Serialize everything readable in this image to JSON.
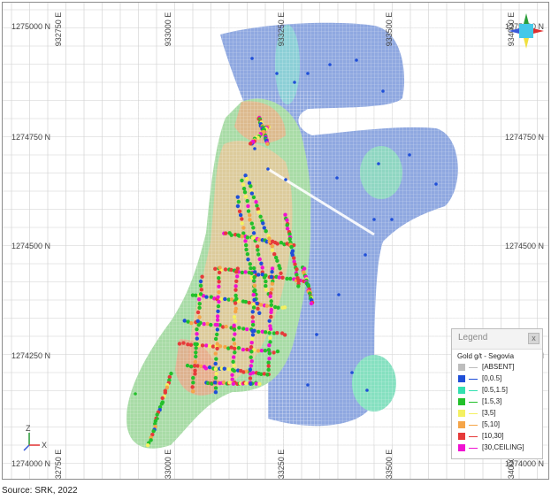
{
  "grid_labels": {
    "easting": [
      "932750 E",
      "933000 E",
      "933250 E",
      "933500 E",
      "934000 E"
    ],
    "northing": [
      "1275000 N",
      "1274750 N",
      "1274500 N",
      "1274250 N",
      "1274000 N"
    ]
  },
  "right_labels": [
    "1274750 N",
    "1274500 N",
    "1274250 N",
    "1275000 N",
    "1274000 N"
  ],
  "axis_triad": {
    "x": "X",
    "z": "Z"
  },
  "legend": {
    "title": "Legend",
    "close": "x",
    "subtitle": "Gold g/t - Segovia",
    "items": [
      {
        "label": "[ABSENT]",
        "color": "#bdbdbd"
      },
      {
        "label": "[0,0.5]",
        "color": "#1f4fd8"
      },
      {
        "label": "[0.5,1.5]",
        "color": "#33e0b0"
      },
      {
        "label": "[1.5,3]",
        "color": "#22c02a"
      },
      {
        "label": "[3,5]",
        "color": "#f4f061"
      },
      {
        "label": "[5,10]",
        "color": "#f5a548"
      },
      {
        "label": "[10,30]",
        "color": "#e63a3a"
      },
      {
        "label": "[30,CEILING]",
        "color": "#f012d2"
      }
    ]
  },
  "source": "Source: SRK, 2022"
}
